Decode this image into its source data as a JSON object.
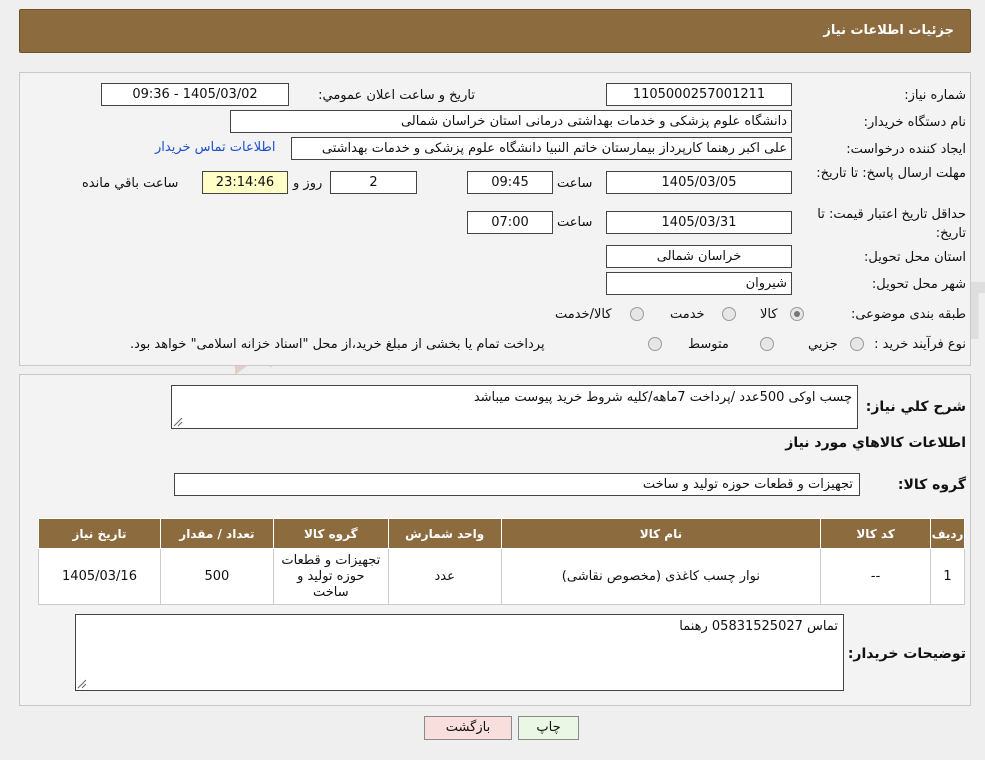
{
  "header": {
    "title": "جزئیات اطلاعات نیاز"
  },
  "form": {
    "need_number_label": "شماره نیاز:",
    "need_number": "1105000257001211",
    "announce_label": "تاریخ و ساعت اعلان عمومي:",
    "announce_value": "1405/03/02 - 09:36",
    "buyer_org_label": "نام دستگاه خریدار:",
    "buyer_org": "دانشگاه علوم پزشکی و خدمات بهداشتی درمانی استان خراسان شمالی",
    "creator_label": "ایجاد کننده درخواست:",
    "creator": "علی اکبر رهنما کارپرداز بیمارستان خاتم النبیا دانشگاه علوم پزشکی و خدمات بهداشتی",
    "contact_link": "اطلاعات تماس خریدار",
    "reply_deadline_label": "مهلت ارسال پاسخ: تا تاریخ:",
    "reply_date": "1405/03/05",
    "time_label": "ساعت",
    "reply_time": "09:45",
    "days_value": "2",
    "days_label": "روز و",
    "remaining_time": "23:14:46",
    "remaining_label": "ساعت باقي مانده",
    "price_validity_label": "حداقل تاریخ اعتبار قیمت: تا تاریخ:",
    "price_date": "1405/03/31",
    "price_time": "07:00",
    "province_label": "استان محل تحویل:",
    "province": "خراسان شمالی",
    "city_label": "شهر محل تحویل:",
    "city": "شیروان",
    "category_label": "طبقه بندی موضوعی:",
    "category_options": [
      "کالا",
      "خدمت",
      "کالا/خدمت"
    ],
    "category_selected": "کالا",
    "process_label": "نوع فرآیند خرید :",
    "process_options": [
      "جزيي",
      "متوسط"
    ],
    "process_note": "پرداخت تمام یا بخشی از مبلغ خرید،از محل \"اسناد خزانه اسلامی\" خواهد بود."
  },
  "summary": {
    "description_label": "شرح کلي نياز:",
    "description": "چسب اوکی 500عدد /پرداخت 7ماهه/کلیه شروط خرید پیوست میباشد",
    "goods_info_title": "اطلاعات کالاهاي مورد نياز",
    "goods_group_label": "گروه کالا:",
    "goods_group": "تجهیزات و قطعات حوزه تولید و ساخت"
  },
  "table": {
    "headers": [
      "رديف",
      "کد کالا",
      "نام کالا",
      "واحد شمارش",
      "گروه کالا",
      "تعداد / مقدار",
      "تاریخ نیاز"
    ],
    "rows": [
      {
        "row": "1",
        "code": "--",
        "name": "نوار چسب کاغذی (مخصوص نقاشی)",
        "unit": "عدد",
        "group": "تجهیزات و قطعات حوزه تولید و ساخت",
        "qty": "500",
        "date": "1405/03/16"
      }
    ]
  },
  "buyer_notes": {
    "label": "توضیحات خریدار:",
    "value": "تماس 05831525027 رهنما"
  },
  "buttons": {
    "print": "چاپ",
    "back": "بازگشت"
  },
  "watermark": {
    "text": "AriaTender.neT"
  },
  "colors": {
    "header": "#8c6c3e",
    "link": "#1a4fd0",
    "print_button": "#eaf7e4",
    "back_button": "#f9dede"
  }
}
